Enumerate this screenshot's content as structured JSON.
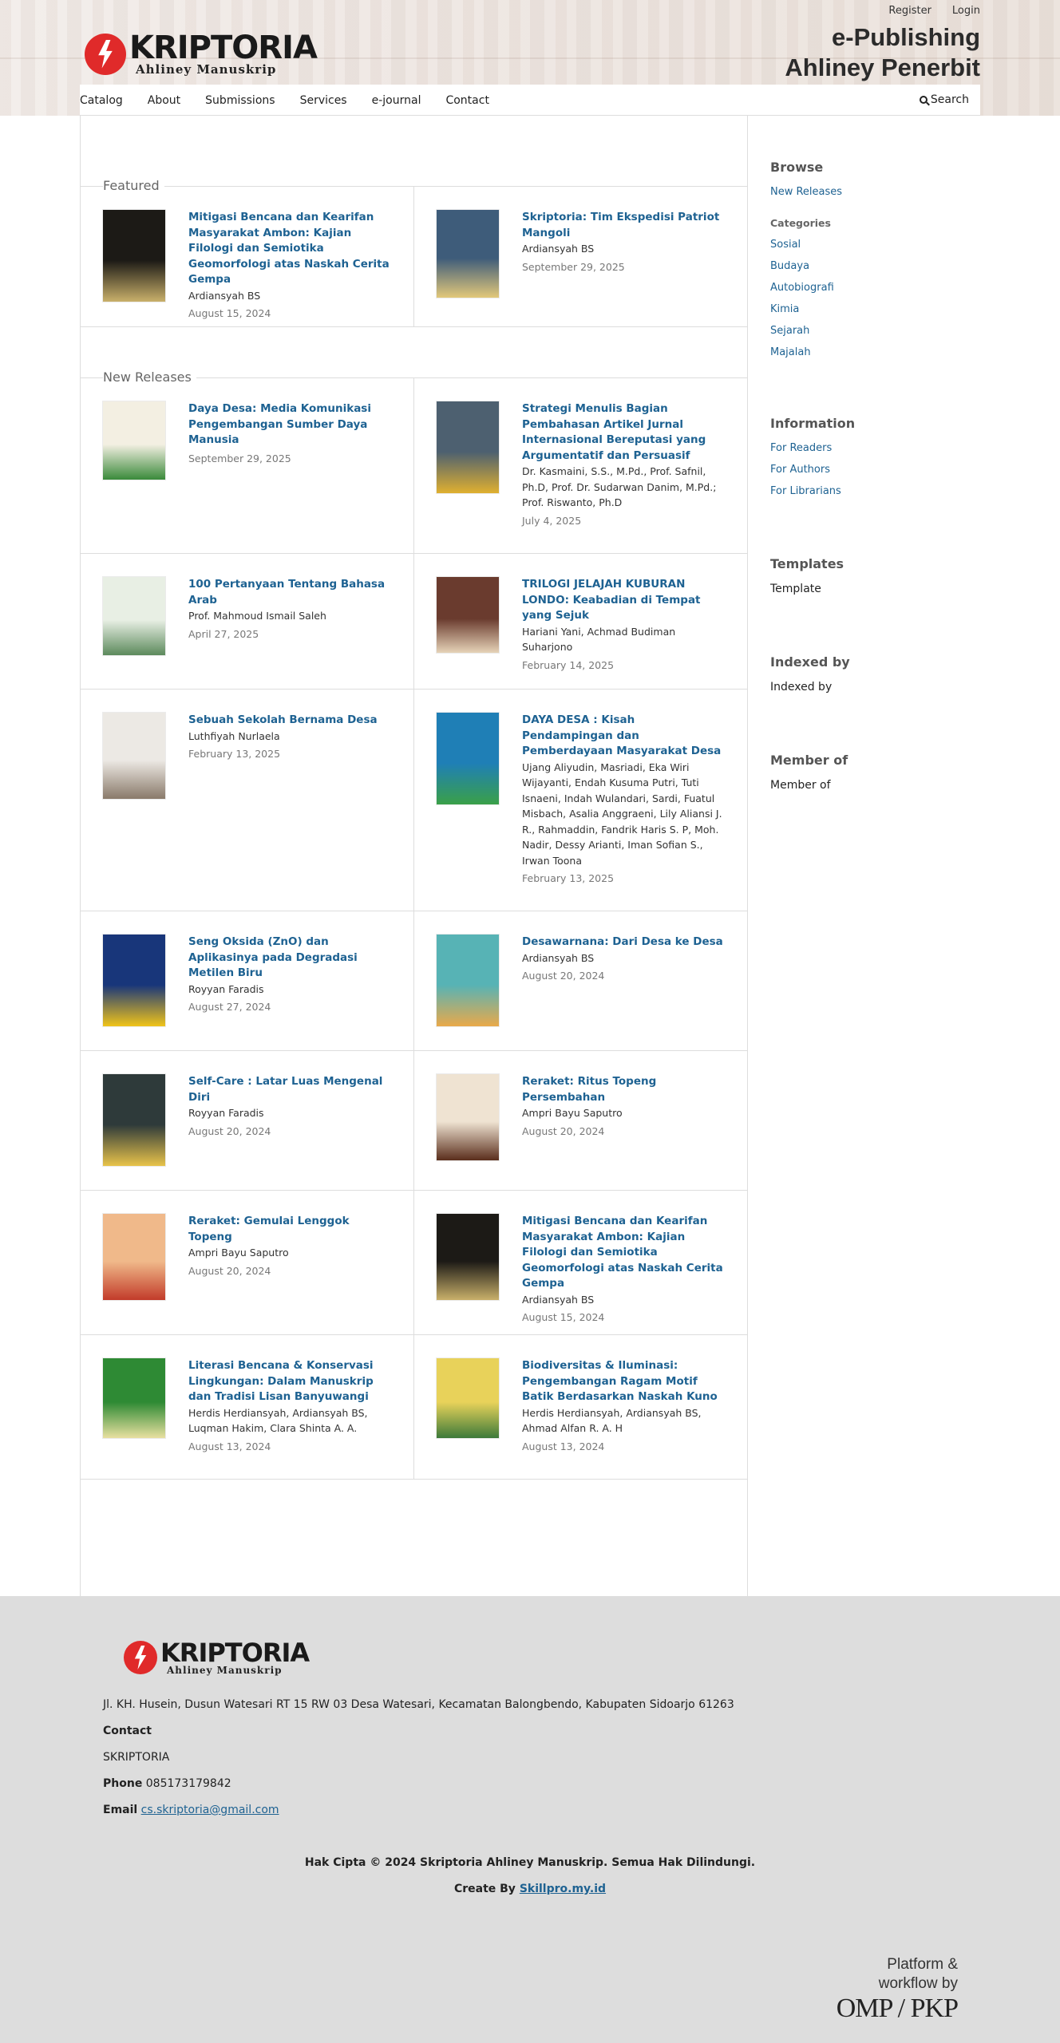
{
  "header": {
    "register": "Register",
    "login": "Login",
    "logo_title": "KRIPTORIA",
    "logo_sub": "Ahliney Manuskrip",
    "site_title_1": "e-Publishing",
    "site_title_2": "Ahliney Penerbit"
  },
  "nav": {
    "items": [
      "Catalog",
      "About",
      "Submissions",
      "Services",
      "e-journal",
      "Contact"
    ],
    "search": "Search"
  },
  "featured": {
    "label": "Featured",
    "books": [
      {
        "title": "Mitigasi Bencana dan Kearifan Masyarakat Ambon: Kajian Filologi dan Semiotika Geomorfologi atas Naskah Cerita Gempa",
        "author": "Ardiansyah BS",
        "date": "August 15, 2024",
        "cover_bg": "#1c1a16",
        "cover_accent": "#c9b06a"
      },
      {
        "title": "Skriptoria: Tim Ekspedisi Patriot Mangoli",
        "author": "Ardiansyah BS",
        "date": "September 29, 2025",
        "cover_bg": "#3e5c7a",
        "cover_accent": "#e2c87a"
      }
    ]
  },
  "releases": {
    "label": "New Releases",
    "books": [
      {
        "title": "Daya Desa: Media Komunikasi Pengembangan Sumber Daya Manusia",
        "author": "",
        "date": "September 29, 2025",
        "cover_bg": "#f3efe2",
        "cover_accent": "#3a8a3a"
      },
      {
        "title": "Strategi Menulis Bagian Pembahasan Artikel Jurnal Internasional Bereputasi yang Argumentatif dan Persuasif",
        "author": "Dr. Kasmaini, S.S., M.Pd., Prof. Safnil, Ph.D, Prof. Dr. Sudarwan Danim, M.Pd.; Prof. Riswanto, Ph.D",
        "date": "July 4, 2025",
        "cover_bg": "#4d6070",
        "cover_accent": "#e0b030"
      },
      {
        "title": "100 Pertanyaan Tentang Bahasa Arab",
        "author": "Prof. Mahmoud Ismail Saleh",
        "date": "April 27, 2025",
        "cover_bg": "#e8efe4",
        "cover_accent": "#5c8a5c"
      },
      {
        "title": "TRILOGI JELAJAH KUBURAN LONDO: Keabadian di Tempat yang Sejuk",
        "author": "Hariani Yani, Achmad Budiman Suharjono",
        "date": "February 14, 2025",
        "cover_bg": "#6a3b2e",
        "cover_accent": "#e6d3b8"
      },
      {
        "title": "Sebuah Sekolah Bernama Desa",
        "author": "Luthfiyah Nurlaela",
        "date": "February 13, 2025",
        "cover_bg": "#ece9e4",
        "cover_accent": "#8a7a6a"
      },
      {
        "title": "DAYA DESA : Kisah Pendampingan dan Pemberdayaan Masyarakat Desa",
        "author": "Ujang Aliyudin, Masriadi, Eka Wiri Wijayanti, Endah Kusuma Putri, Tuti Isnaeni, Indah Wulandari, Sardi, Fuatul Misbach, Asalia Anggraeni, Lily Aliansi J. R., Rahmaddin, Fandrik Haris S. P, Moh. Nadir, Dessy Arianti, Iman Sofian S., Irwan Toona",
        "date": "February 13, 2025",
        "cover_bg": "#1f7fb6",
        "cover_accent": "#3aa048"
      },
      {
        "title": "Seng Oksida (ZnO) dan Aplikasinya pada Degradasi Metilen Biru",
        "author": "Royyan Faradis",
        "date": "August 27, 2024",
        "cover_bg": "#18367a",
        "cover_accent": "#f0c419"
      },
      {
        "title": "Desawarnana: Dari Desa ke Desa",
        "author": "Ardiansyah BS",
        "date": "August 20, 2024",
        "cover_bg": "#57b3b5",
        "cover_accent": "#e9a94a"
      },
      {
        "title": "Self-Care : Latar Luas Mengenal Diri",
        "author": "Royyan Faradis",
        "date": "August 20, 2024",
        "cover_bg": "#2e3a3a",
        "cover_accent": "#e8c34a"
      },
      {
        "title": "Reraket: Ritus Topeng Persembahan",
        "author": "Ampri Bayu Saputro",
        "date": "August 20, 2024",
        "cover_bg": "#efe3d2",
        "cover_accent": "#5a2e1c"
      },
      {
        "title": "Reraket: Gemulai Lenggok Topeng",
        "author": "Ampri Bayu Saputro",
        "date": "August 20, 2024",
        "cover_bg": "#f0b98a",
        "cover_accent": "#c23b2a"
      },
      {
        "title": "Mitigasi Bencana dan Kearifan Masyarakat Ambon: Kajian Filologi dan Semiotika Geomorfologi atas Naskah Cerita Gempa",
        "author": "Ardiansyah BS",
        "date": "August 15, 2024",
        "cover_bg": "#1c1a16",
        "cover_accent": "#c9b06a"
      },
      {
        "title": "Literasi Bencana & Konservasi Lingkungan: Dalam Manuskrip dan Tradisi Lisan Banyuwangi",
        "author": "Herdis Herdiansyah, Ardiansyah BS, Luqman Hakim, Clara Shinta A. A.",
        "date": "August 13, 2024",
        "cover_bg": "#2e8a34",
        "cover_accent": "#e8e0a0"
      },
      {
        "title": "Biodiversitas & Iluminasi: Pengembangan Ragam Motif Batik Berdasarkan Naskah Kuno",
        "author": "Herdis Herdiansyah, Ardiansyah BS, Ahmad Alfan R. A. H",
        "date": "August 13, 2024",
        "cover_bg": "#e8d25a",
        "cover_accent": "#3d7a3a"
      }
    ]
  },
  "sidebar": {
    "browse": "Browse",
    "new_releases": "New Releases",
    "categories_label": "Categories",
    "categories": [
      "Sosial",
      "Budaya",
      "Autobiografi",
      "Kimia",
      "Sejarah",
      "Majalah"
    ],
    "information": "Information",
    "info_links": [
      "For Readers",
      "For Authors",
      "For Librarians"
    ],
    "templates": "Templates",
    "template_text": "Template",
    "indexed": "Indexed by",
    "indexed_text": "Indexed by",
    "member": "Member of",
    "member_text": "Member of"
  },
  "footer": {
    "address": "Jl. KH. Husein, Dusun Watesari RT 15 RW 03 Desa Watesari, Kecamatan Balongbendo, Kabupaten Sidoarjo 61263",
    "contact_label": "Contact",
    "org": "SKRIPTORIA",
    "phone_label": "Phone",
    "phone": "085173179842",
    "email_label": "Email",
    "email": "cs.skriptoria@gmail.com",
    "copyright": "Hak Cipta © 2024 Skriptoria Ahliney Manuskrip. Semua Hak Dilindungi.",
    "create_by": "Create By",
    "create_link": "Skillpro.my.id",
    "pkp_1": "Platform &",
    "pkp_2": "workflow by",
    "pkp_3": "OMP / PKP"
  },
  "colors": {
    "link": "#1e6292",
    "footer_bg": "#dddddd",
    "logo_red": "#e02a2a"
  }
}
